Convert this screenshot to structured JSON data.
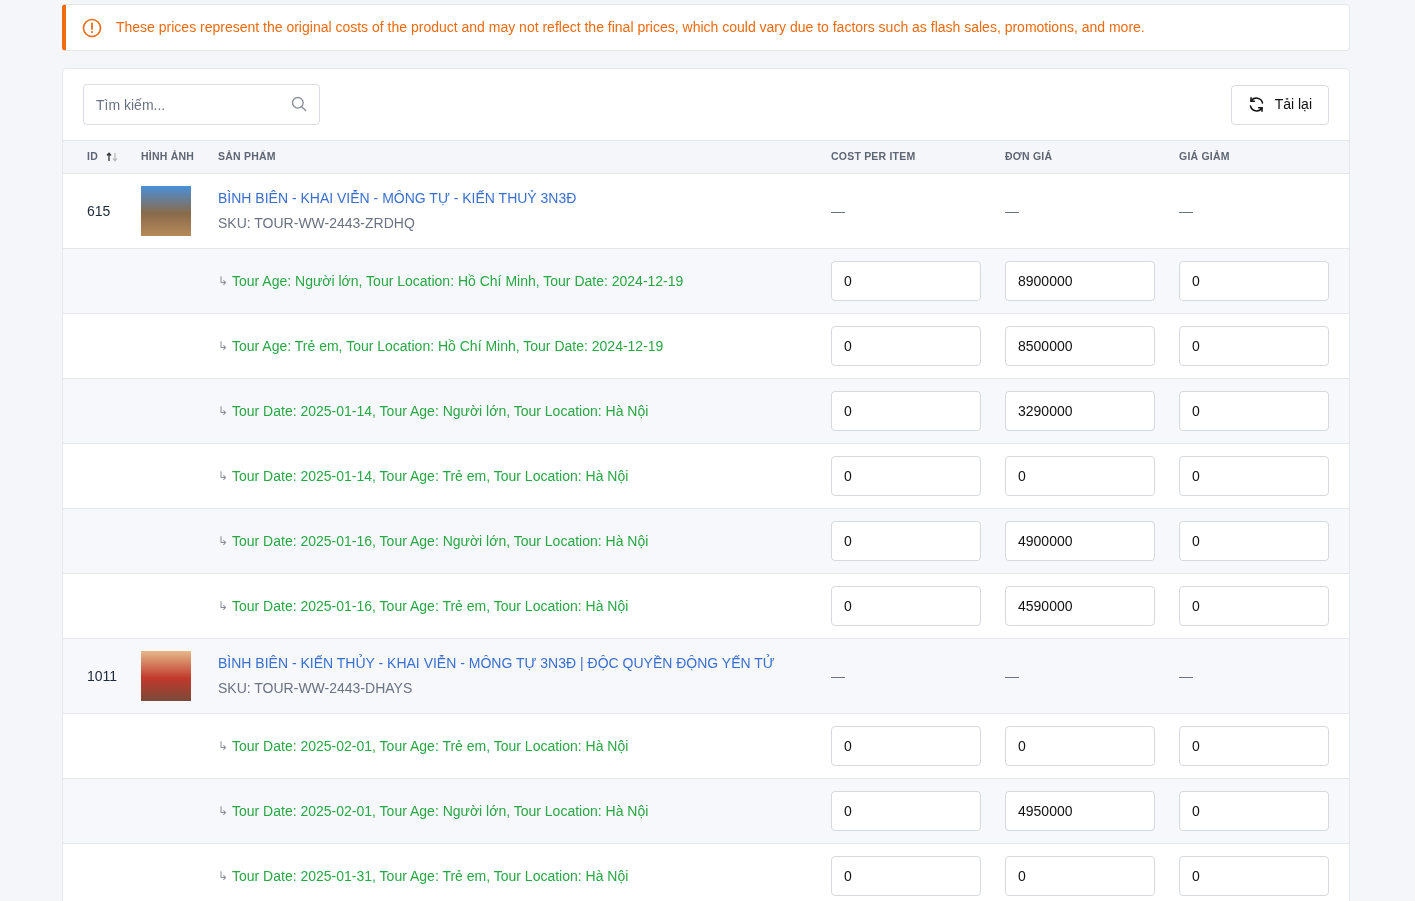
{
  "alert": {
    "text": "These prices represent the original costs of the product and may not reflect the final prices, which could vary due to factors such as flash sales, promotions, and more."
  },
  "toolbar": {
    "search": {
      "placeholder": "Tìm kiếm..."
    },
    "reload_button": "Tải lại"
  },
  "table": {
    "columns": [
      {
        "label": "ID",
        "sortable": true
      },
      {
        "label": "HÌNH ẢNH",
        "sortable": false
      },
      {
        "label": "SẢN PHẨM",
        "sortable": false
      },
      {
        "label": "COST PER ITEM",
        "sortable": false
      },
      {
        "label": "ĐƠN GIÁ",
        "sortable": false
      },
      {
        "label": "GIÁ GIẢM",
        "sortable": false
      }
    ],
    "products": [
      {
        "id": "615",
        "name": "BÌNH BIÊN - KHAI VIỄN - MÔNG TỰ - KIẾN THUỶ 3N3Đ",
        "sku": "SKU: TOUR-WW-2443-ZRDHQ",
        "cost": "—",
        "price": "—",
        "discount": "—",
        "variants": [
          {
            "prefix": "↳",
            "label": "Tour Age: Người lớn, Tour Location: Hồ Chí Minh, Tour Date: 2024-12-19",
            "cost": "0",
            "price": "8900000",
            "discount": "0"
          },
          {
            "prefix": "↳",
            "label": "Tour Age: Trẻ em, Tour Location: Hồ Chí Minh, Tour Date: 2024-12-19",
            "cost": "0",
            "price": "8500000",
            "discount": "0"
          },
          {
            "prefix": "↳",
            "label": "Tour Date: 2025-01-14, Tour Age: Người lớn, Tour Location: Hà Nội",
            "cost": "0",
            "price": "3290000",
            "discount": "0"
          },
          {
            "prefix": "↳",
            "label": "Tour Date: 2025-01-14, Tour Age: Trẻ em, Tour Location: Hà Nội",
            "cost": "0",
            "price": "0",
            "discount": "0"
          },
          {
            "prefix": "↳",
            "label": "Tour Date: 2025-01-16, Tour Age: Người lớn, Tour Location: Hà Nội",
            "cost": "0",
            "price": "4900000",
            "discount": "0"
          },
          {
            "prefix": "↳",
            "label": "Tour Date: 2025-01-16, Tour Age: Trẻ em, Tour Location: Hà Nội",
            "cost": "0",
            "price": "4590000",
            "discount": "0"
          }
        ]
      },
      {
        "id": "1011",
        "name": "BÌNH BIÊN - KIẾN THỦY - KHAI VIỄN - MÔNG TỰ 3N3Đ | ĐỘC QUYỀN ĐỘNG YẾN TỬ",
        "sku": "SKU: TOUR-WW-2443-DHAYS",
        "cost": "—",
        "price": "—",
        "discount": "—",
        "variants": [
          {
            "prefix": "↳",
            "label": "Tour Date: 2025-02-01, Tour Age: Trẻ em, Tour Location: Hà Nội",
            "cost": "0",
            "price": "0",
            "discount": "0"
          },
          {
            "prefix": "↳",
            "label": "Tour Date: 2025-02-01, Tour Age: Người lớn, Tour Location: Hà Nội",
            "cost": "0",
            "price": "4950000",
            "discount": "0"
          },
          {
            "prefix": "↳",
            "label": "Tour Date: 2025-01-31, Tour Age: Trẻ em, Tour Location: Hà Nội",
            "cost": "0",
            "price": "0",
            "discount": "0"
          }
        ]
      }
    ]
  }
}
